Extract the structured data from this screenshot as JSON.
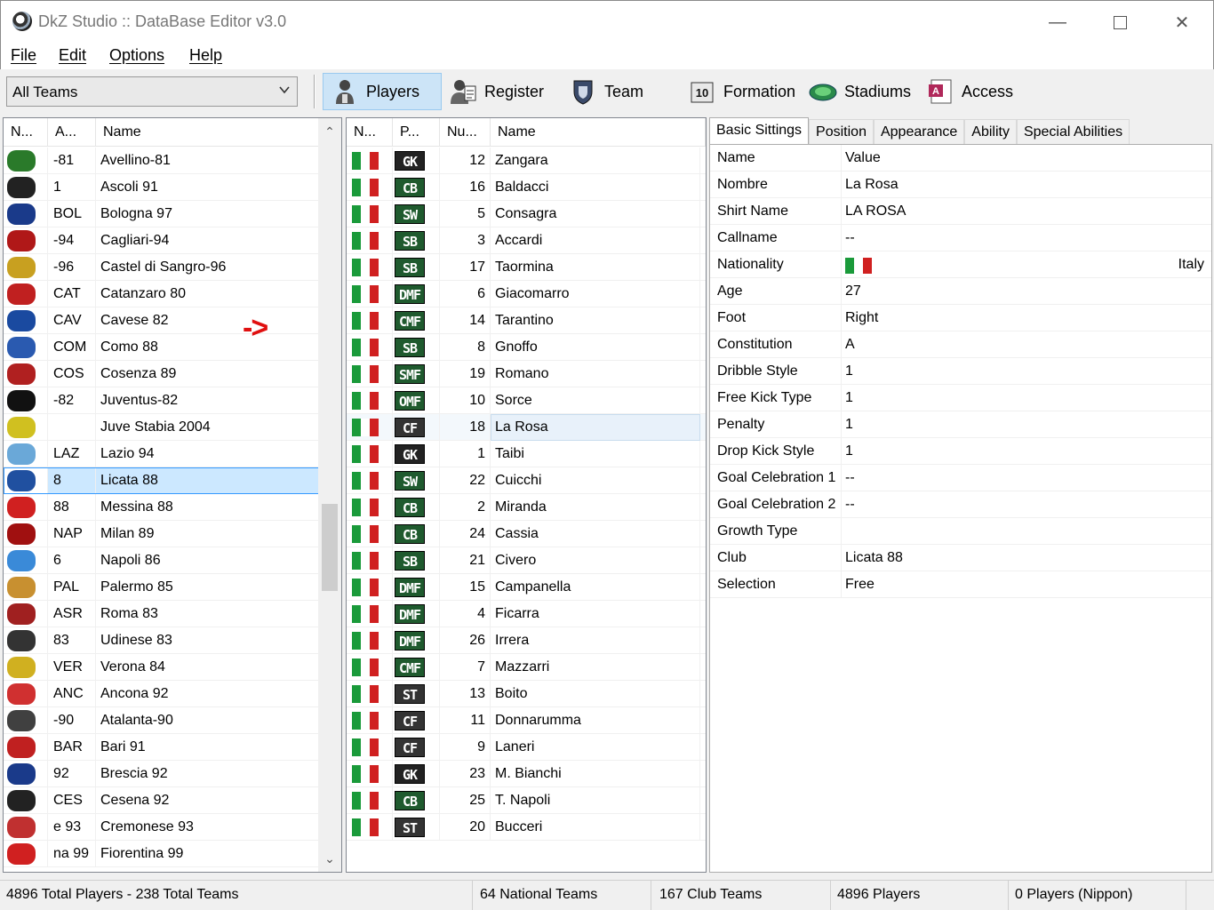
{
  "window": {
    "title": "DkZ Studio :: DataBase Editor v3.0"
  },
  "menu": [
    {
      "label": "File"
    },
    {
      "label": "Edit"
    },
    {
      "label": "Options"
    },
    {
      "label": "Help"
    }
  ],
  "toolbar": {
    "team_filter": "All Teams",
    "buttons": [
      {
        "label": "Players",
        "icon": "player-icon"
      },
      {
        "label": "Register",
        "icon": "register-icon"
      },
      {
        "label": "Team",
        "icon": "team-icon"
      },
      {
        "label": "Formation",
        "icon": "formation-icon"
      },
      {
        "label": "Stadiums",
        "icon": "stadium-icon"
      },
      {
        "label": "Access",
        "icon": "access-icon"
      }
    ]
  },
  "teams_table": {
    "columns": [
      "N...",
      "A...",
      "Name"
    ],
    "rows": [
      {
        "abbr": "-81",
        "name": "Avellino-81",
        "color": "#2a7a2a"
      },
      {
        "abbr": "1",
        "name": "Ascoli 91",
        "color": "#222222"
      },
      {
        "abbr": "BOL",
        "name": "Bologna 97",
        "color": "#1a3a8a"
      },
      {
        "abbr": "-94",
        "name": "Cagliari-94",
        "color": "#b01818"
      },
      {
        "abbr": "-96",
        "name": "Castel di Sangro-96",
        "color": "#c8a020"
      },
      {
        "abbr": "CAT",
        "name": "Catanzaro 80",
        "color": "#c02020"
      },
      {
        "abbr": "CAV",
        "name": "Cavese 82",
        "color": "#1a4aa0"
      },
      {
        "abbr": "COM",
        "name": "Como 88",
        "color": "#2a5ab0"
      },
      {
        "abbr": "COS",
        "name": "Cosenza 89",
        "color": "#b02020"
      },
      {
        "abbr": "-82",
        "name": "Juventus-82",
        "color": "#111111"
      },
      {
        "abbr": "",
        "name": "Juve Stabia 2004",
        "color": "#d0c020"
      },
      {
        "abbr": "LAZ",
        "name": "Lazio 94",
        "color": "#6aa8d8"
      },
      {
        "abbr": "8",
        "name": "Licata 88",
        "color": "#2050a0"
      },
      {
        "abbr": "88",
        "name": "Messina 88",
        "color": "#d02020"
      },
      {
        "abbr": "NAP",
        "name": "Milan 89",
        "color": "#a01010"
      },
      {
        "abbr": "6",
        "name": "Napoli 86",
        "color": "#3a8ad8"
      },
      {
        "abbr": "PAL",
        "name": "Palermo 85",
        "color": "#c89030"
      },
      {
        "abbr": "ASR",
        "name": "Roma 83",
        "color": "#a02020"
      },
      {
        "abbr": "83",
        "name": "Udinese 83",
        "color": "#333333"
      },
      {
        "abbr": "VER",
        "name": "Verona 84",
        "color": "#d0b020"
      },
      {
        "abbr": "ANC",
        "name": "Ancona 92",
        "color": "#d03030"
      },
      {
        "abbr": "-90",
        "name": "Atalanta-90",
        "color": "#404040"
      },
      {
        "abbr": "BAR",
        "name": "Bari 91",
        "color": "#c02020"
      },
      {
        "abbr": "92",
        "name": "Brescia 92",
        "color": "#1a3a8a"
      },
      {
        "abbr": "CES",
        "name": "Cesena 92",
        "color": "#222222"
      },
      {
        "abbr": "e 93",
        "name": "Cremonese 93",
        "color": "#c03030"
      },
      {
        "abbr": "na 99",
        "name": "Fiorentina 99",
        "color": "#d02020"
      }
    ],
    "selected_index": 12
  },
  "players_table": {
    "columns": [
      "N...",
      "P...",
      "Nu...",
      "Name"
    ],
    "rows": [
      {
        "pos": "GK",
        "num": "12",
        "name": "Zangara"
      },
      {
        "pos": "CB",
        "num": "16",
        "name": "Baldacci"
      },
      {
        "pos": "SW",
        "num": "5",
        "name": "Consagra"
      },
      {
        "pos": "SB",
        "num": "3",
        "name": "Accardi"
      },
      {
        "pos": "SB",
        "num": "17",
        "name": "Taormina"
      },
      {
        "pos": "DMF",
        "num": "6",
        "name": "Giacomarro"
      },
      {
        "pos": "CMF",
        "num": "14",
        "name": "Tarantino"
      },
      {
        "pos": "SB",
        "num": "8",
        "name": "Gnoffo"
      },
      {
        "pos": "SMF",
        "num": "19",
        "name": "Romano"
      },
      {
        "pos": "OMF",
        "num": "10",
        "name": "Sorce"
      },
      {
        "pos": "CF",
        "num": "18",
        "name": "La Rosa"
      },
      {
        "pos": "GK",
        "num": "1",
        "name": "Taibi"
      },
      {
        "pos": "SW",
        "num": "22",
        "name": "Cuicchi"
      },
      {
        "pos": "CB",
        "num": "2",
        "name": "Miranda"
      },
      {
        "pos": "CB",
        "num": "24",
        "name": "Cassia"
      },
      {
        "pos": "SB",
        "num": "21",
        "name": "Civero"
      },
      {
        "pos": "DMF",
        "num": "15",
        "name": "Campanella"
      },
      {
        "pos": "DMF",
        "num": "4",
        "name": "Ficarra"
      },
      {
        "pos": "DMF",
        "num": "26",
        "name": "Irrera"
      },
      {
        "pos": "CMF",
        "num": "7",
        "name": "Mazzarri"
      },
      {
        "pos": "ST",
        "num": "13",
        "name": "Boito"
      },
      {
        "pos": "CF",
        "num": "11",
        "name": "Donnarumma"
      },
      {
        "pos": "CF",
        "num": "9",
        "name": "Laneri"
      },
      {
        "pos": "GK",
        "num": "23",
        "name": "M. Bianchi"
      },
      {
        "pos": "CB",
        "num": "25",
        "name": "T. Napoli"
      },
      {
        "pos": "ST",
        "num": "20",
        "name": "Bucceri"
      }
    ],
    "selected_index": 10,
    "flag_colors": [
      "#1a9a3a",
      "#ffffff",
      "#d02020"
    ]
  },
  "annotation": "->",
  "detail_tabs": [
    "Basic Sittings",
    "Position",
    "Appearance",
    "Ability",
    "Special Abilities"
  ],
  "properties": {
    "header": {
      "key": "Name",
      "value": "Value"
    },
    "rows": [
      {
        "key": "Nombre",
        "value": "La Rosa"
      },
      {
        "key": "Shirt Name",
        "value": "LA ROSA"
      },
      {
        "key": "Callname",
        "value": "--"
      },
      {
        "key": "Nationality",
        "value": "Italy",
        "flag": true
      },
      {
        "key": "Age",
        "value": "27"
      },
      {
        "key": "Foot",
        "value": "Right"
      },
      {
        "key": "Constitution",
        "value": "A"
      },
      {
        "key": "Dribble Style",
        "value": "1"
      },
      {
        "key": "Free Kick Type",
        "value": "1"
      },
      {
        "key": "Penalty",
        "value": "1"
      },
      {
        "key": "Drop Kick Style",
        "value": "1"
      },
      {
        "key": "Goal Celebration 1",
        "value": "--"
      },
      {
        "key": "Goal Celebration 2",
        "value": "--"
      },
      {
        "key": "Growth Type",
        "value": ""
      },
      {
        "key": "Club",
        "value": "Licata 88"
      },
      {
        "key": "Selection",
        "value": "Free"
      }
    ]
  },
  "status": {
    "totals": "4896 Total Players  -  238 Total Teams",
    "national": "64 National Teams",
    "club": "167 Club Teams",
    "players": "4896 Players",
    "nippon": "0 Players (Nippon)"
  }
}
